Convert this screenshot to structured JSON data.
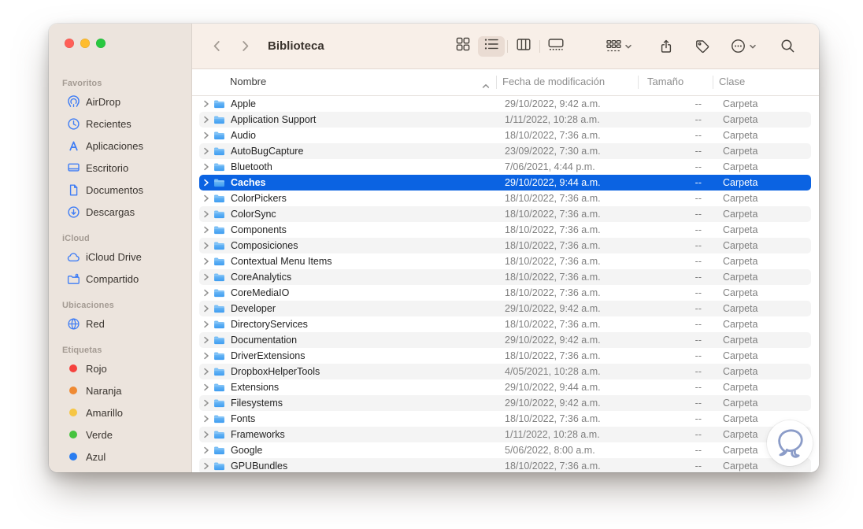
{
  "window": {
    "title": "Biblioteca",
    "traffic_lights": [
      "close",
      "minimize",
      "zoom"
    ]
  },
  "toolbar": {
    "back_icon": "chevron-left-icon",
    "forward_icon": "chevron-right-icon",
    "view_buttons": [
      {
        "name": "view-grid",
        "icon": "grid-view-icon",
        "active": false
      },
      {
        "name": "view-list",
        "icon": "list-view-icon",
        "active": true
      },
      {
        "name": "view-columns",
        "icon": "column-view-icon",
        "active": false
      },
      {
        "name": "view-gallery",
        "icon": "gallery-view-icon",
        "active": false
      }
    ],
    "tools": [
      {
        "name": "group-button",
        "icon": "group-icon",
        "has_dropdown": true
      },
      {
        "name": "share-button",
        "icon": "share-icon",
        "has_dropdown": false
      },
      {
        "name": "tags-button",
        "icon": "tag-icon",
        "has_dropdown": false
      },
      {
        "name": "more-button",
        "icon": "ellipsis-circle-icon",
        "has_dropdown": true
      }
    ],
    "search_icon": "search-icon"
  },
  "sidebar": {
    "sections": [
      {
        "title": "Favoritos",
        "items": [
          {
            "label": "AirDrop",
            "icon": "airdrop-icon"
          },
          {
            "label": "Recientes",
            "icon": "clock-icon"
          },
          {
            "label": "Aplicaciones",
            "icon": "applications-icon"
          },
          {
            "label": "Escritorio",
            "icon": "desktop-icon"
          },
          {
            "label": "Documentos",
            "icon": "document-icon"
          },
          {
            "label": "Descargas",
            "icon": "download-icon"
          }
        ]
      },
      {
        "title": "iCloud",
        "items": [
          {
            "label": "iCloud Drive",
            "icon": "cloud-icon"
          },
          {
            "label": "Compartido",
            "icon": "shared-folder-icon"
          }
        ]
      },
      {
        "title": "Ubicaciones",
        "items": [
          {
            "label": "Red",
            "icon": "globe-icon"
          }
        ]
      },
      {
        "title": "Etiquetas",
        "items": [
          {
            "label": "Rojo",
            "icon": "tag-dot",
            "color": "#f5423e"
          },
          {
            "label": "Naranja",
            "icon": "tag-dot",
            "color": "#ef8a33"
          },
          {
            "label": "Amarillo",
            "icon": "tag-dot",
            "color": "#f6c644"
          },
          {
            "label": "Verde",
            "icon": "tag-dot",
            "color": "#46c33f"
          },
          {
            "label": "Azul",
            "icon": "tag-dot",
            "color": "#2a7df0"
          }
        ]
      }
    ]
  },
  "list": {
    "columns": [
      "Nombre",
      "Fecha de modificación",
      "Tamaño",
      "Clase"
    ],
    "sort_column": "Nombre",
    "sort_direction": "asc",
    "rows": [
      {
        "name": "Apple",
        "date": "29/10/2022, 9:42 a.m.",
        "size": "--",
        "kind": "Carpeta",
        "selected": false
      },
      {
        "name": "Application Support",
        "date": "1/11/2022, 10:28 a.m.",
        "size": "--",
        "kind": "Carpeta",
        "selected": false
      },
      {
        "name": "Audio",
        "date": "18/10/2022, 7:36 a.m.",
        "size": "--",
        "kind": "Carpeta",
        "selected": false
      },
      {
        "name": "AutoBugCapture",
        "date": "23/09/2022, 7:30 a.m.",
        "size": "--",
        "kind": "Carpeta",
        "selected": false
      },
      {
        "name": "Bluetooth",
        "date": "7/06/2021, 4:44 p.m.",
        "size": "--",
        "kind": "Carpeta",
        "selected": false
      },
      {
        "name": "Caches",
        "date": "29/10/2022, 9:44 a.m.",
        "size": "--",
        "kind": "Carpeta",
        "selected": true
      },
      {
        "name": "ColorPickers",
        "date": "18/10/2022, 7:36 a.m.",
        "size": "--",
        "kind": "Carpeta",
        "selected": false
      },
      {
        "name": "ColorSync",
        "date": "18/10/2022, 7:36 a.m.",
        "size": "--",
        "kind": "Carpeta",
        "selected": false
      },
      {
        "name": "Components",
        "date": "18/10/2022, 7:36 a.m.",
        "size": "--",
        "kind": "Carpeta",
        "selected": false
      },
      {
        "name": "Composiciones",
        "date": "18/10/2022, 7:36 a.m.",
        "size": "--",
        "kind": "Carpeta",
        "selected": false
      },
      {
        "name": "Contextual Menu Items",
        "date": "18/10/2022, 7:36 a.m.",
        "size": "--",
        "kind": "Carpeta",
        "selected": false
      },
      {
        "name": "CoreAnalytics",
        "date": "18/10/2022, 7:36 a.m.",
        "size": "--",
        "kind": "Carpeta",
        "selected": false
      },
      {
        "name": "CoreMediaIO",
        "date": "18/10/2022, 7:36 a.m.",
        "size": "--",
        "kind": "Carpeta",
        "selected": false
      },
      {
        "name": "Developer",
        "date": "29/10/2022, 9:42 a.m.",
        "size": "--",
        "kind": "Carpeta",
        "selected": false
      },
      {
        "name": "DirectoryServices",
        "date": "18/10/2022, 7:36 a.m.",
        "size": "--",
        "kind": "Carpeta",
        "selected": false
      },
      {
        "name": "Documentation",
        "date": "29/10/2022, 9:42 a.m.",
        "size": "--",
        "kind": "Carpeta",
        "selected": false
      },
      {
        "name": "DriverExtensions",
        "date": "18/10/2022, 7:36 a.m.",
        "size": "--",
        "kind": "Carpeta",
        "selected": false
      },
      {
        "name": "DropboxHelperTools",
        "date": "4/05/2021, 10:28 a.m.",
        "size": "--",
        "kind": "Carpeta",
        "selected": false
      },
      {
        "name": "Extensions",
        "date": "29/10/2022, 9:44 a.m.",
        "size": "--",
        "kind": "Carpeta",
        "selected": false
      },
      {
        "name": "Filesystems",
        "date": "29/10/2022, 9:42 a.m.",
        "size": "--",
        "kind": "Carpeta",
        "selected": false
      },
      {
        "name": "Fonts",
        "date": "18/10/2022, 7:36 a.m.",
        "size": "--",
        "kind": "Carpeta",
        "selected": false
      },
      {
        "name": "Frameworks",
        "date": "1/11/2022, 10:28 a.m.",
        "size": "--",
        "kind": "Carpeta",
        "selected": false
      },
      {
        "name": "Google",
        "date": "5/06/2022, 8:00 a.m.",
        "size": "--",
        "kind": "Carpeta",
        "selected": false
      },
      {
        "name": "GPUBundles",
        "date": "18/10/2022, 7:36 a.m.",
        "size": "--",
        "kind": "Carpeta",
        "selected": false
      }
    ]
  },
  "watermark": {
    "icon": "speech-bubble-logo"
  },
  "colors": {
    "selection_blue": "#0b63e2",
    "sidebar_bg": "#ece4dd",
    "toolbar_bg": "#f8efe8",
    "alt_row": "#f4f4f4",
    "sidebar_accent_blue": "#3f7df5",
    "folder_blue_top": "#7fc3f7",
    "folder_blue_bottom": "#3e9df1",
    "traffic_red": "#ff5f57",
    "traffic_yellow": "#febc2e",
    "traffic_green": "#28c840"
  }
}
